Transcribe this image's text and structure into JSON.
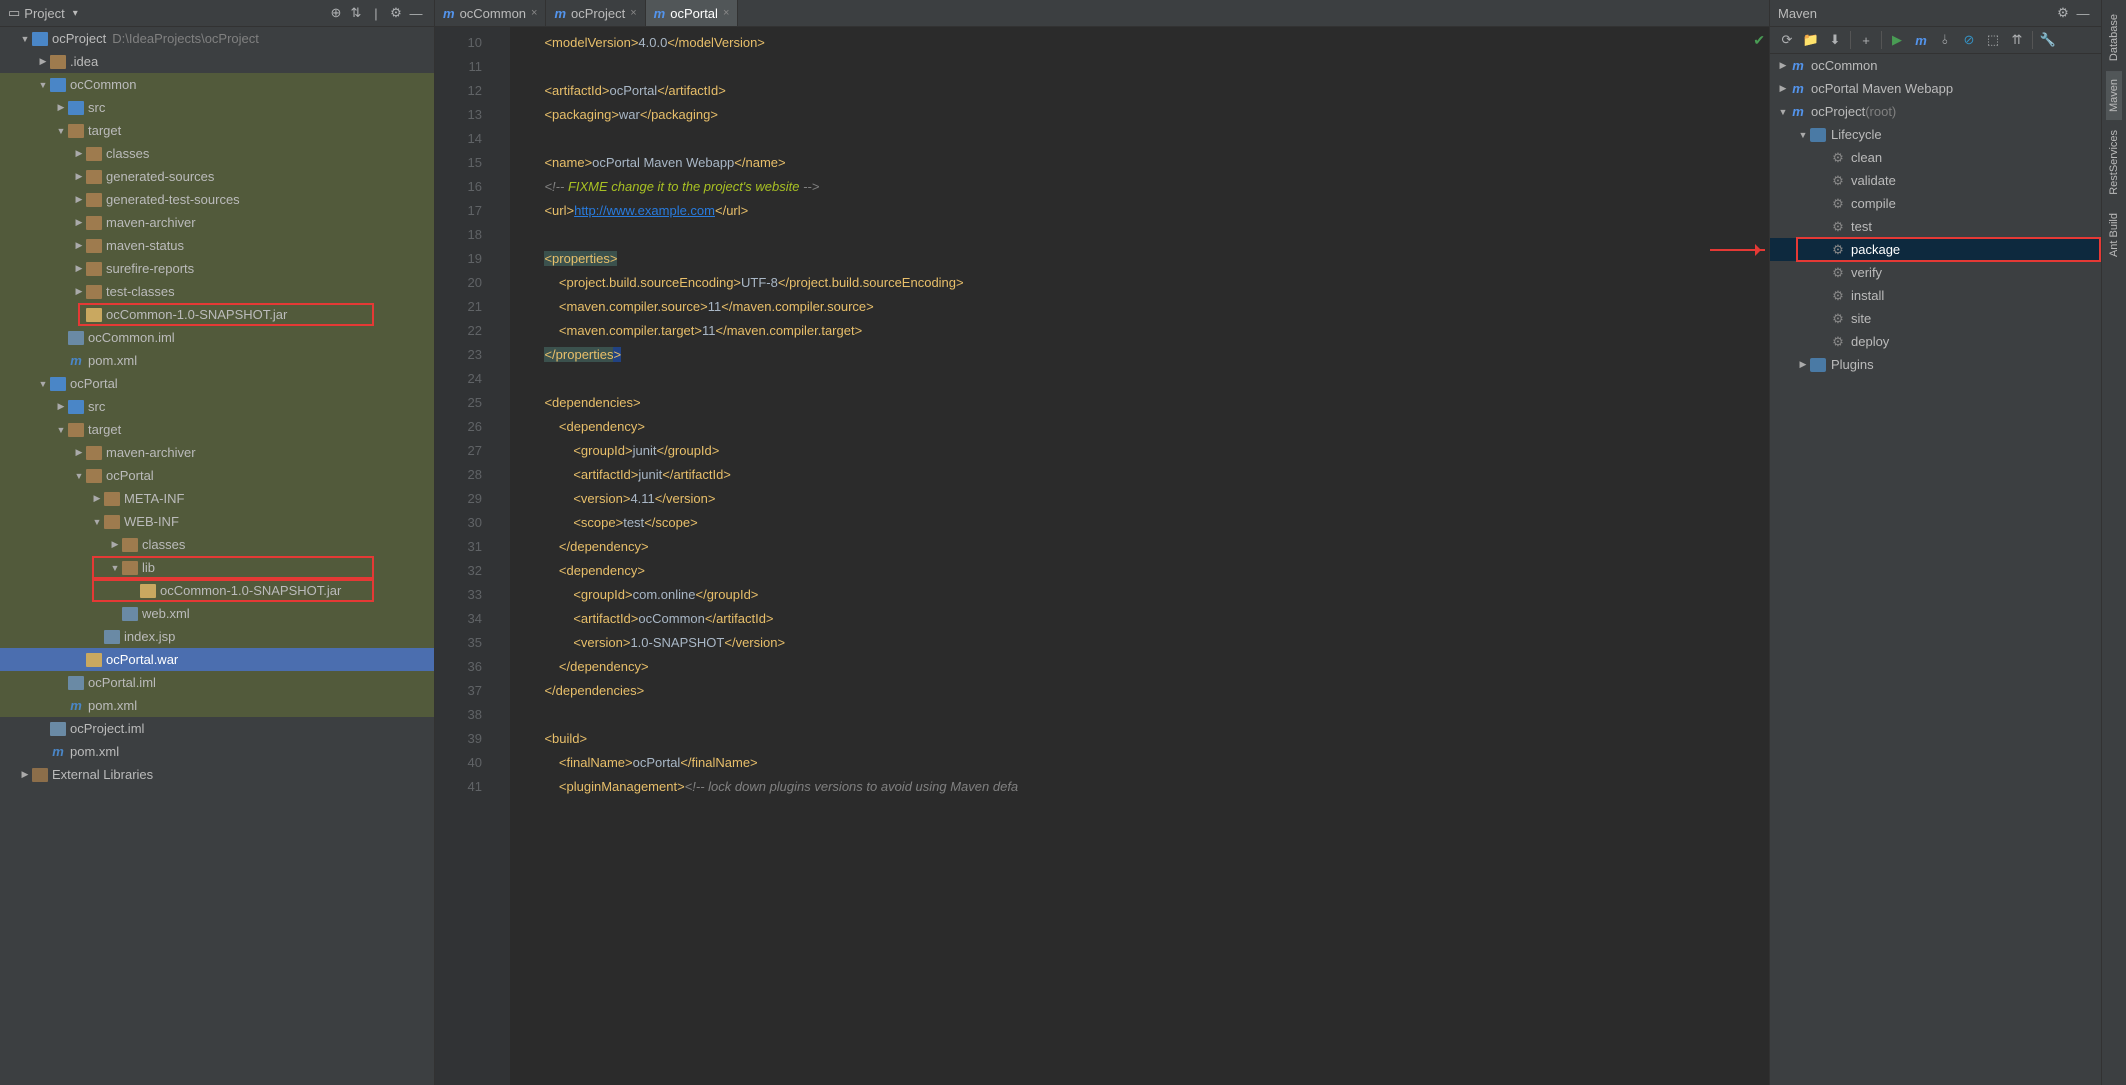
{
  "projectPanel": {
    "title": "Project",
    "root": {
      "label": "ocProject",
      "path": "D:\\IdeaProjects\\ocProject"
    },
    "items": [
      {
        "d": 1,
        "a": "open",
        "i": "module",
        "l": "ocProject",
        "p": "D:\\IdeaProjects\\ocProject"
      },
      {
        "d": 2,
        "a": "closed",
        "i": "folder",
        "l": ".idea"
      },
      {
        "d": 2,
        "a": "open",
        "i": "module",
        "l": "ocCommon",
        "olive": true
      },
      {
        "d": 3,
        "a": "closed",
        "i": "folder-blue",
        "l": "src",
        "olive": true
      },
      {
        "d": 3,
        "a": "open",
        "i": "folder",
        "l": "target",
        "olive": true
      },
      {
        "d": 4,
        "a": "closed",
        "i": "folder",
        "l": "classes",
        "olive": true
      },
      {
        "d": 4,
        "a": "closed",
        "i": "folder",
        "l": "generated-sources",
        "olive": true
      },
      {
        "d": 4,
        "a": "closed",
        "i": "folder",
        "l": "generated-test-sources",
        "olive": true
      },
      {
        "d": 4,
        "a": "closed",
        "i": "folder",
        "l": "maven-archiver",
        "olive": true
      },
      {
        "d": 4,
        "a": "closed",
        "i": "folder",
        "l": "maven-status",
        "olive": true
      },
      {
        "d": 4,
        "a": "closed",
        "i": "folder",
        "l": "surefire-reports",
        "olive": true
      },
      {
        "d": 4,
        "a": "closed",
        "i": "folder",
        "l": "test-classes",
        "olive": true
      },
      {
        "d": 4,
        "a": "none",
        "i": "jar",
        "l": "ocCommon-1.0-SNAPSHOT.jar",
        "olive": true,
        "red": 1
      },
      {
        "d": 3,
        "a": "none",
        "i": "file",
        "l": "ocCommon.iml",
        "olive": true
      },
      {
        "d": 3,
        "a": "none",
        "i": "m",
        "l": "pom.xml",
        "olive": true
      },
      {
        "d": 2,
        "a": "open",
        "i": "module",
        "l": "ocPortal",
        "olive": true
      },
      {
        "d": 3,
        "a": "closed",
        "i": "folder-blue",
        "l": "src",
        "olive": true
      },
      {
        "d": 3,
        "a": "open",
        "i": "folder",
        "l": "target",
        "olive": true
      },
      {
        "d": 4,
        "a": "closed",
        "i": "folder",
        "l": "maven-archiver",
        "olive": true
      },
      {
        "d": 4,
        "a": "open",
        "i": "folder",
        "l": "ocPortal",
        "olive": true
      },
      {
        "d": 5,
        "a": "closed",
        "i": "folder",
        "l": "META-INF",
        "olive": true
      },
      {
        "d": 5,
        "a": "open",
        "i": "folder",
        "l": "WEB-INF",
        "olive": true
      },
      {
        "d": 6,
        "a": "closed",
        "i": "folder",
        "l": "classes",
        "olive": true
      },
      {
        "d": 6,
        "a": "open",
        "i": "folder",
        "l": "lib",
        "olive": true,
        "red": 2
      },
      {
        "d": 7,
        "a": "none",
        "i": "jar",
        "l": "ocCommon-1.0-SNAPSHOT.jar",
        "olive": true,
        "red": 2
      },
      {
        "d": 6,
        "a": "none",
        "i": "file",
        "l": "web.xml",
        "olive": true
      },
      {
        "d": 5,
        "a": "none",
        "i": "file",
        "l": "index.jsp",
        "olive": true
      },
      {
        "d": 4,
        "a": "none",
        "i": "jar",
        "l": "ocPortal.war",
        "sel": true
      },
      {
        "d": 3,
        "a": "none",
        "i": "file",
        "l": "ocPortal.iml",
        "olive": true
      },
      {
        "d": 3,
        "a": "none",
        "i": "m",
        "l": "pom.xml",
        "olive": true
      },
      {
        "d": 2,
        "a": "none",
        "i": "file",
        "l": "ocProject.iml"
      },
      {
        "d": 2,
        "a": "none",
        "i": "m",
        "l": "pom.xml"
      },
      {
        "d": 1,
        "a": "closed",
        "i": "lib",
        "l": "External Libraries"
      }
    ]
  },
  "editor": {
    "tabs": [
      {
        "label": "ocCommon",
        "active": false
      },
      {
        "label": "ocProject",
        "active": false
      },
      {
        "label": "ocPortal",
        "active": true
      }
    ],
    "startLine": 10,
    "lines": [
      {
        "n": 10,
        "h": "    <span class='t'>&lt;modelVersion&gt;</span><span class='tx'>4.0.0</span><span class='t'>&lt;/modelVersion&gt;</span>"
      },
      {
        "n": 11,
        "h": ""
      },
      {
        "n": 12,
        "h": "    <span class='t'>&lt;artifactId&gt;</span><span class='tx'>ocPortal</span><span class='t'>&lt;/artifactId&gt;</span>"
      },
      {
        "n": 13,
        "h": "    <span class='t'>&lt;packaging&gt;</span><span class='tx'>war</span><span class='t'>&lt;/packaging&gt;</span>"
      },
      {
        "n": 14,
        "h": ""
      },
      {
        "n": 15,
        "h": "    <span class='t'>&lt;name&gt;</span><span class='tx'>ocPortal Maven Webapp</span><span class='t'>&lt;/name&gt;</span>"
      },
      {
        "n": 16,
        "h": "    <span class='cm'>&lt;!-- </span><span class='cm2'>FIXME change it to the project's website</span><span class='cm'> --&gt;</span>"
      },
      {
        "n": 17,
        "h": "    <span class='t'>&lt;url&gt;</span><span class='ln'>http://www.example.com</span><span class='t'>&lt;/url&gt;</span>"
      },
      {
        "n": 18,
        "h": ""
      },
      {
        "n": 19,
        "h": "    <span class='hlbg2'><span class='t'>&lt;</span><span class='tn'>properties</span><span class='t'>&gt;</span></span>"
      },
      {
        "n": 20,
        "h": "        <span class='t'>&lt;project.build.sourceEncoding&gt;</span><span class='tx'>UTF-8</span><span class='t'>&lt;/project.build.sourceEncoding&gt;</span>"
      },
      {
        "n": 21,
        "h": "        <span class='t'>&lt;maven.compiler.source&gt;</span><span class='tx'>11</span><span class='t'>&lt;/maven.compiler.source&gt;</span>"
      },
      {
        "n": 22,
        "h": "        <span class='t'>&lt;maven.compiler.target&gt;</span><span class='tx'>11</span><span class='t'>&lt;/maven.compiler.target&gt;</span>"
      },
      {
        "n": 23,
        "h": "    <span class='hlbg2'><span class='t'>&lt;/</span><span class='tn'>properties</span></span><span class='hlbg'><span class='t'>&gt;</span></span>"
      },
      {
        "n": 24,
        "h": ""
      },
      {
        "n": 25,
        "h": "    <span class='t'>&lt;dependencies&gt;</span>"
      },
      {
        "n": 26,
        "h": "        <span class='t'>&lt;dependency&gt;</span>"
      },
      {
        "n": 27,
        "h": "            <span class='t'>&lt;groupId&gt;</span><span class='tx'>junit</span><span class='t'>&lt;/groupId&gt;</span>"
      },
      {
        "n": 28,
        "h": "            <span class='t'>&lt;artifactId&gt;</span><span class='tx'>junit</span><span class='t'>&lt;/artifactId&gt;</span>"
      },
      {
        "n": 29,
        "h": "            <span class='t'>&lt;version&gt;</span><span class='tx'>4.11</span><span class='t'>&lt;/version&gt;</span>"
      },
      {
        "n": 30,
        "h": "            <span class='t'>&lt;scope&gt;</span><span class='tx'>test</span><span class='t'>&lt;/scope&gt;</span>"
      },
      {
        "n": 31,
        "h": "        <span class='t'>&lt;/dependency&gt;</span>"
      },
      {
        "n": 32,
        "h": "        <span class='t'>&lt;dependency&gt;</span>"
      },
      {
        "n": 33,
        "h": "            <span class='t'>&lt;groupId&gt;</span><span class='tx'>com.online</span><span class='t'>&lt;/groupId&gt;</span>"
      },
      {
        "n": 34,
        "h": "            <span class='t'>&lt;artifactId&gt;</span><span class='tx'>ocCommon</span><span class='t'>&lt;/artifactId&gt;</span>"
      },
      {
        "n": 35,
        "h": "            <span class='t'>&lt;version&gt;</span><span class='tx'>1.0-SNAPSHOT</span><span class='t'>&lt;/version&gt;</span>"
      },
      {
        "n": 36,
        "h": "        <span class='t'>&lt;/dependency&gt;</span>"
      },
      {
        "n": 37,
        "h": "    <span class='t'>&lt;/dependencies&gt;</span>"
      },
      {
        "n": 38,
        "h": ""
      },
      {
        "n": 39,
        "h": "    <span class='t'>&lt;build&gt;</span>"
      },
      {
        "n": 40,
        "h": "        <span class='t'>&lt;finalName&gt;</span><span class='tx'>ocPortal</span><span class='t'>&lt;/finalName&gt;</span>"
      },
      {
        "n": 41,
        "h": "        <span class='t'>&lt;pluginManagement&gt;</span><span class='cm'>&lt;!-- lock down plugins versions to avoid using Maven defa</span>"
      }
    ]
  },
  "maven": {
    "title": "Maven",
    "items": [
      {
        "d": 0,
        "a": "closed",
        "i": "m",
        "l": "ocCommon"
      },
      {
        "d": 0,
        "a": "closed",
        "i": "m",
        "l": "ocPortal Maven Webapp"
      },
      {
        "d": 0,
        "a": "open",
        "i": "m",
        "l": "ocProject",
        "suf": "(root)"
      },
      {
        "d": 1,
        "a": "open",
        "i": "life",
        "l": "Lifecycle"
      },
      {
        "d": 2,
        "a": "none",
        "i": "gear",
        "l": "clean"
      },
      {
        "d": 2,
        "a": "none",
        "i": "gear",
        "l": "validate"
      },
      {
        "d": 2,
        "a": "none",
        "i": "gear",
        "l": "compile"
      },
      {
        "d": 2,
        "a": "none",
        "i": "gear",
        "l": "test"
      },
      {
        "d": 2,
        "a": "none",
        "i": "gear",
        "l": "package",
        "sel": true,
        "red": true
      },
      {
        "d": 2,
        "a": "none",
        "i": "gear",
        "l": "verify"
      },
      {
        "d": 2,
        "a": "none",
        "i": "gear",
        "l": "install"
      },
      {
        "d": 2,
        "a": "none",
        "i": "gear",
        "l": "site"
      },
      {
        "d": 2,
        "a": "none",
        "i": "gear",
        "l": "deploy"
      },
      {
        "d": 1,
        "a": "closed",
        "i": "plugin",
        "l": "Plugins"
      }
    ]
  },
  "rail": [
    {
      "l": "Database"
    },
    {
      "l": "Maven",
      "active": true
    },
    {
      "l": "RestServices"
    },
    {
      "l": "Ant Build"
    }
  ]
}
